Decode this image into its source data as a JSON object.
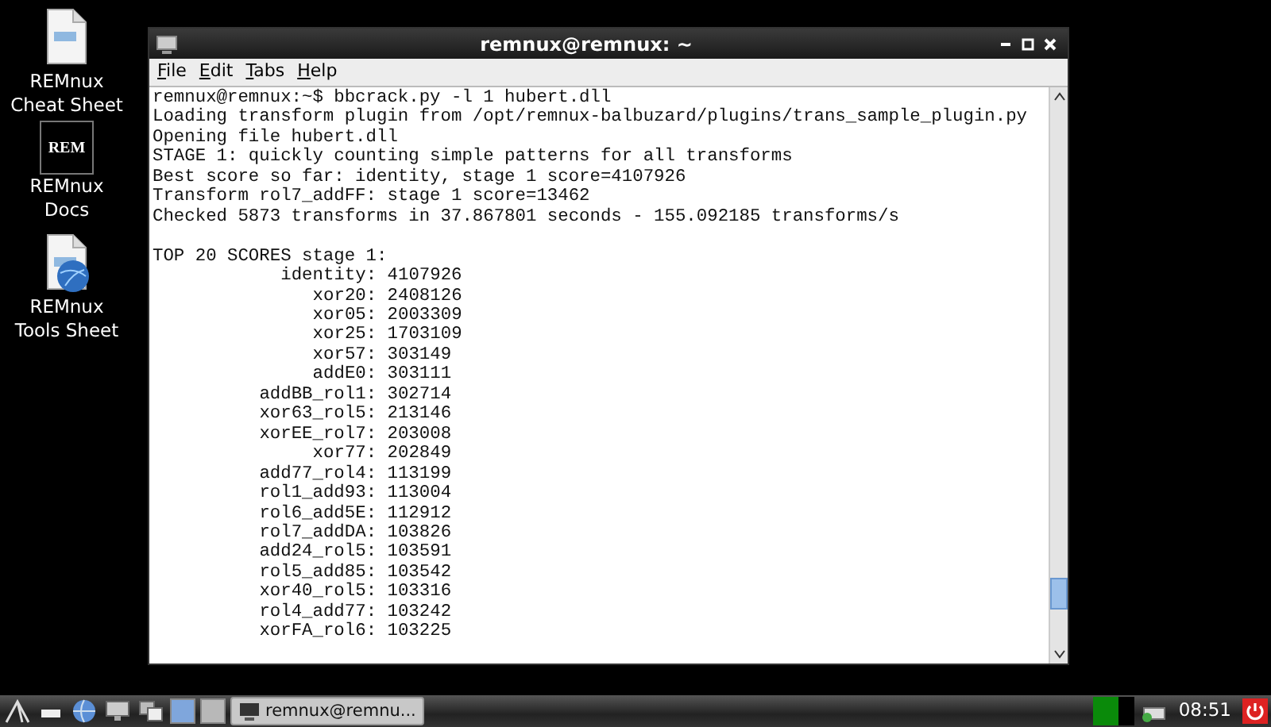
{
  "desktop_icons": [
    {
      "kind": "document",
      "label": "REMnux Cheat Sheet"
    },
    {
      "kind": "logo",
      "logo_text": "REM",
      "label": "REMnux Docs"
    },
    {
      "kind": "globe-document",
      "label": "REMnux Tools Sheet"
    }
  ],
  "window": {
    "title": "remnux@remnux: ~",
    "menu": [
      "File",
      "Edit",
      "Tabs",
      "Help"
    ],
    "lines": [
      {
        "kind": "text",
        "text": "remnux@remnux:~$ bbcrack.py -l 1 hubert.dll"
      },
      {
        "kind": "text",
        "text": "Loading transform plugin from /opt/remnux-balbuzard/plugins/trans_sample_plugin.py"
      },
      {
        "kind": "text",
        "text": "Opening file hubert.dll"
      },
      {
        "kind": "text",
        "text": "STAGE 1: quickly counting simple patterns for all transforms"
      },
      {
        "kind": "text",
        "text": "Best score so far: identity, stage 1 score=4107926"
      },
      {
        "kind": "text",
        "text": "Transform rol7_addFF: stage 1 score=13462"
      },
      {
        "kind": "text",
        "text": "Checked 5873 transforms in 37.867801 seconds - 155.092185 transforms/s"
      },
      {
        "kind": "blank"
      },
      {
        "kind": "text",
        "text": "TOP 20 SCORES stage 1:"
      },
      {
        "kind": "score",
        "text": "identity: 4107926"
      },
      {
        "kind": "score",
        "text": "xor20: 2408126"
      },
      {
        "kind": "score",
        "text": "xor05: 2003309"
      },
      {
        "kind": "score",
        "text": "xor25: 1703109"
      },
      {
        "kind": "score",
        "text": "xor57: 303149"
      },
      {
        "kind": "score",
        "text": "addE0: 303111"
      },
      {
        "kind": "score",
        "text": "addBB_rol1: 302714"
      },
      {
        "kind": "score",
        "text": "xor63_rol5: 213146"
      },
      {
        "kind": "score",
        "text": "xorEE_rol7: 203008"
      },
      {
        "kind": "score",
        "text": "xor77: 202849"
      },
      {
        "kind": "score",
        "text": "add77_rol4: 113199"
      },
      {
        "kind": "score",
        "text": "rol1_add93: 113004"
      },
      {
        "kind": "score",
        "text": "rol6_add5E: 112912"
      },
      {
        "kind": "score",
        "text": "rol7_addDA: 103826"
      },
      {
        "kind": "score",
        "text": "add24_rol5: 103591"
      },
      {
        "kind": "score",
        "text": "rol5_add85: 103542"
      },
      {
        "kind": "score",
        "text": "xor40_rol5: 103316"
      },
      {
        "kind": "score",
        "text": "rol4_add77: 103242"
      },
      {
        "kind": "score",
        "text": "xorFA_rol6: 103225"
      }
    ]
  },
  "taskbar": {
    "launchers": [
      {
        "kind": "menu"
      },
      {
        "kind": "show-desktop"
      },
      {
        "kind": "browser"
      },
      {
        "kind": "terminal"
      },
      {
        "kind": "windows"
      }
    ],
    "workspaces": [
      {
        "selected": true
      },
      {
        "selected": false
      }
    ],
    "tasks": [
      {
        "label": "remnux@remnu...",
        "selected": true
      }
    ],
    "clock": "08:51"
  }
}
